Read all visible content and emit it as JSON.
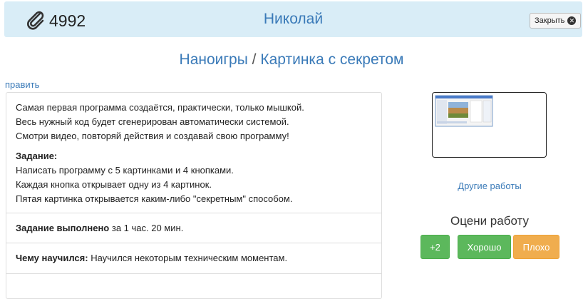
{
  "header": {
    "id_number": "4992",
    "name": "Николай",
    "close_label": "Закрыть"
  },
  "title": {
    "category": "Наноигры",
    "separator": "/",
    "work_title": "Картинка с секретом"
  },
  "edit_link": "править",
  "description": {
    "lines": [
      "Самая первая программа создаётся, практически, только мышкой.",
      "Весь нужный код будет сгенерирован автоматически системой.",
      "Смотри видео, повторяй действия и создавай свою программу!"
    ],
    "task_label": "Задание:",
    "task_lines": [
      "Написать программу с 5 картинками и 4 кнопками.",
      "Каждая кнопка открывает одну из 4 картинок.",
      "Пятая картинка открывается каким-либо \"секретным\" способом."
    ]
  },
  "completed": {
    "label": "Задание выполнено",
    "value": "за 1 час. 20 мин."
  },
  "learned": {
    "label": "Чему научился:",
    "value": "Научился некоторым техническим моментам."
  },
  "sidebar": {
    "other_works": "Другие работы",
    "rate_label": "Оцени работу",
    "plus_label": "+2",
    "good_label": "Хорошо",
    "bad_label": "Плохо"
  },
  "icons": {
    "attachment": "paperclip-icon",
    "close": "close-circle-icon"
  },
  "colors": {
    "header_bg": "#d9edf7",
    "link": "#3a7ab8",
    "green": "#5cb85c",
    "orange": "#f0ad4e"
  }
}
